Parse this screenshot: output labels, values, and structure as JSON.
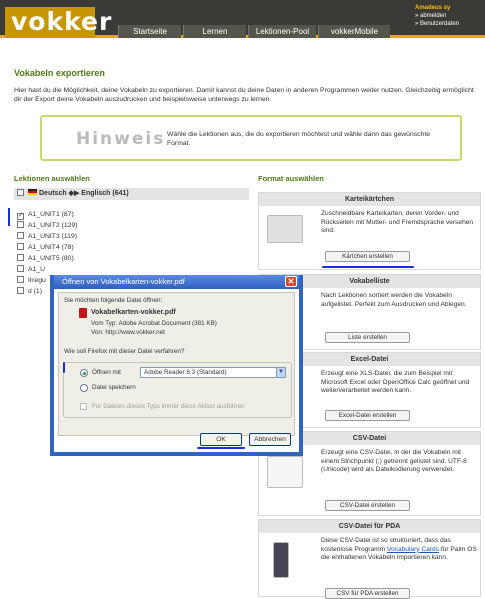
{
  "header": {
    "logo": "vokker",
    "nav": [
      "Startseite",
      "Lernen",
      "Lektionen-Pool",
      "vokkerMobile"
    ],
    "user": "Amadeus sy",
    "links": [
      "» abmelden",
      "» Benutzerdaten"
    ]
  },
  "page": {
    "title": "Vokabeln exportieren",
    "intro": "Hier hast du die Möglichkeit, deine Vokabeln zu exportieren. Damit kannst du deine Daten in anderen Programmen weiter nutzen. Gleichzeitig ermöglicht dir der Export deine Vokabeln auszudrucken und beispielsweise unterwegs zu lernen."
  },
  "hint": {
    "label": "Hinweis",
    "text": "Wähle die Lektionen aus, die du exportieren möchtest und wähle dann das gewünschte Format."
  },
  "lektionen": {
    "title": "Lektionen auswählen",
    "header": "Deutsch ◆▶ Englisch (641)",
    "items": [
      {
        "label": "A1_UNIT1 (87)",
        "checked": true
      },
      {
        "label": "A1_UNIT2 (129)"
      },
      {
        "label": "A1_UNIT3 (119)"
      },
      {
        "label": "A1_UNIT4 (78)"
      },
      {
        "label": "A1_UNIT5 (80)"
      },
      {
        "label": "A1_U"
      },
      {
        "label": "Irregu"
      },
      {
        "label": "d (1)"
      }
    ]
  },
  "format": {
    "title": "Format auswählen",
    "cards": [
      {
        "title": "Karteikärtchen",
        "text": "Zuschneidbare Karteikarten, deren Vorder- und Rückseiten mit Mutter- und Fremdsprache versehen sind.",
        "button": "Kärtchen erstellen"
      },
      {
        "title": "Vokabelliste",
        "text": "Nach Lektionen sortiert werden die Vokabeln aufgelistet. Perfekt zum Ausdrucken und Ablegen.",
        "button": "Liste erstellen"
      },
      {
        "title": "Excel-Datei",
        "text": "Erzeugt eine XLS-Datei, die zum Beispiel mit Microsoft Excel oder OpenOffice Calc geöffnet und weiterverarbeitet werden kann.",
        "button": "Excel-Datei erstellen"
      },
      {
        "title": "CSV-Datei",
        "text": "Erzeugt eine CSV-Datei, in der die Vokabeln mit einem Strichpunkt (;) getrennt gelistet sind. UTF-8 (Unicode) wird als Dateikodierung verwendet.",
        "button": "CSV-Datei erstellen"
      },
      {
        "title": "CSV-Datei für PDA",
        "text_pre": "Diese CSV-Datei ist so strukturiert, dass das kostenlose Programm ",
        "text_link": "Vocabulary Cards",
        "text_post": " für Palm OS die enthaltenen Vokabeln importieren kann.",
        "button": "CSV für PDA erstellen"
      }
    ]
  },
  "dialog": {
    "title": "Öffnen von Vokabelkarten-vokker.pdf",
    "prompt": "Sie möchten folgende Datei öffnen:",
    "filename": "Vokabelkarten-vokker.pdf",
    "type": "Vom Typ:  Adobe Acrobat Document (381 KB)",
    "from": "Von:  http://www.vokker.net",
    "question": "Wie soll Firefox mit dieser Datei verfahren?",
    "open_with": "Öffnen mit",
    "app": "Adobe Reader 8.3 (Standard)",
    "save": "Datei speichern",
    "auto": "Für Dateien dieses Typs immer diese Aktion ausführen",
    "ok": "OK",
    "cancel": "Abbrechen"
  }
}
